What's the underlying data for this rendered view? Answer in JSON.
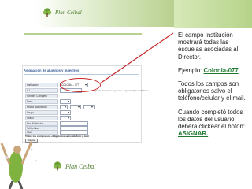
{
  "brand": {
    "name": "Plan Ceibal",
    "colors": {
      "green": "#4a7a2a",
      "accent": "#c62828"
    }
  },
  "form": {
    "title": "Asignación de alumnos y maestros",
    "rows": [
      {
        "label": "Institución",
        "value": "COLONIA - 077",
        "kind": "select"
      },
      {
        "label": "C.I.",
        "value": "",
        "hint": "Ingresar sin puntos ni guiones. Ingresar digito verificador"
      },
      {
        "label": "Nombre Completo",
        "value": ""
      },
      {
        "label": "Sexo",
        "value": "",
        "kind": "select"
      },
      {
        "label": "Fecha Nacimiento",
        "value": "",
        "kind": "date"
      },
      {
        "label": "Grupo",
        "value": "",
        "kind": "select"
      },
      {
        "label": "Grado",
        "value": "",
        "kind": "select"
      },
      {
        "label": "Nro. Matricula",
        "value": ""
      },
      {
        "label": "Tel/Celular",
        "value": ""
      },
      {
        "label": "Mail",
        "value": ""
      }
    ],
    "note": "Todos los campos son obligatorios salvo teléfono y mail",
    "submit_label": "Asignar"
  },
  "instructions": {
    "p1": "El campo Institución mostrará todas las escuelas asociadas al Director.",
    "p2_prefix": "Ejemplo: ",
    "p2_example": "Colonia-077",
    "p3": "Todos los campos son obligatorios salvo el teléfono/celular y el mail.",
    "p4_prefix": "Cuando completó todos los datos del usuario, deberá clickear el botón: ",
    "p4_button": "ASIGNAR."
  }
}
